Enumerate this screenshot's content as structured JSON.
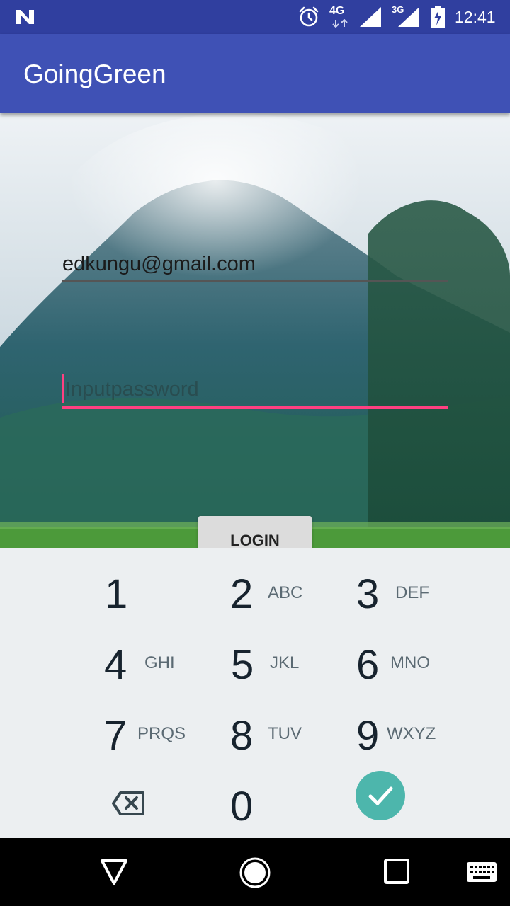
{
  "status_bar": {
    "time": "12:41",
    "network_1": "4G",
    "network_2": "3G",
    "icons": [
      "notification-n-icon",
      "alarm-icon",
      "signal-icon",
      "signal-icon",
      "battery-charging-icon"
    ]
  },
  "app_bar": {
    "title": "GoingGreen"
  },
  "form": {
    "email_value": "edkungu@gmail.com",
    "password_placeholder": "Inputpassword",
    "login_label": "LOGIN"
  },
  "keypad": {
    "keys": [
      {
        "num": "1",
        "letters": ""
      },
      {
        "num": "2",
        "letters": "ABC"
      },
      {
        "num": "3",
        "letters": "DEF"
      },
      {
        "num": "4",
        "letters": "GHI"
      },
      {
        "num": "5",
        "letters": "JKL"
      },
      {
        "num": "6",
        "letters": "MNO"
      },
      {
        "num": "7",
        "letters": "PRQS"
      },
      {
        "num": "8",
        "letters": "TUV"
      },
      {
        "num": "9",
        "letters": "WXYZ"
      },
      {
        "num": "0",
        "letters": ""
      }
    ],
    "icons": {
      "backspace": "backspace-icon",
      "done": "checkmark-icon"
    }
  },
  "nav_bar": {
    "icons": [
      "back-icon",
      "home-icon",
      "recents-icon",
      "keyboard-icon"
    ]
  },
  "colors": {
    "status_bar": "#303F9F",
    "app_bar": "#3F51B5",
    "accent": "#FF4081",
    "done_button": "#4DB6AC",
    "keypad_bg": "#ECEFF1"
  }
}
